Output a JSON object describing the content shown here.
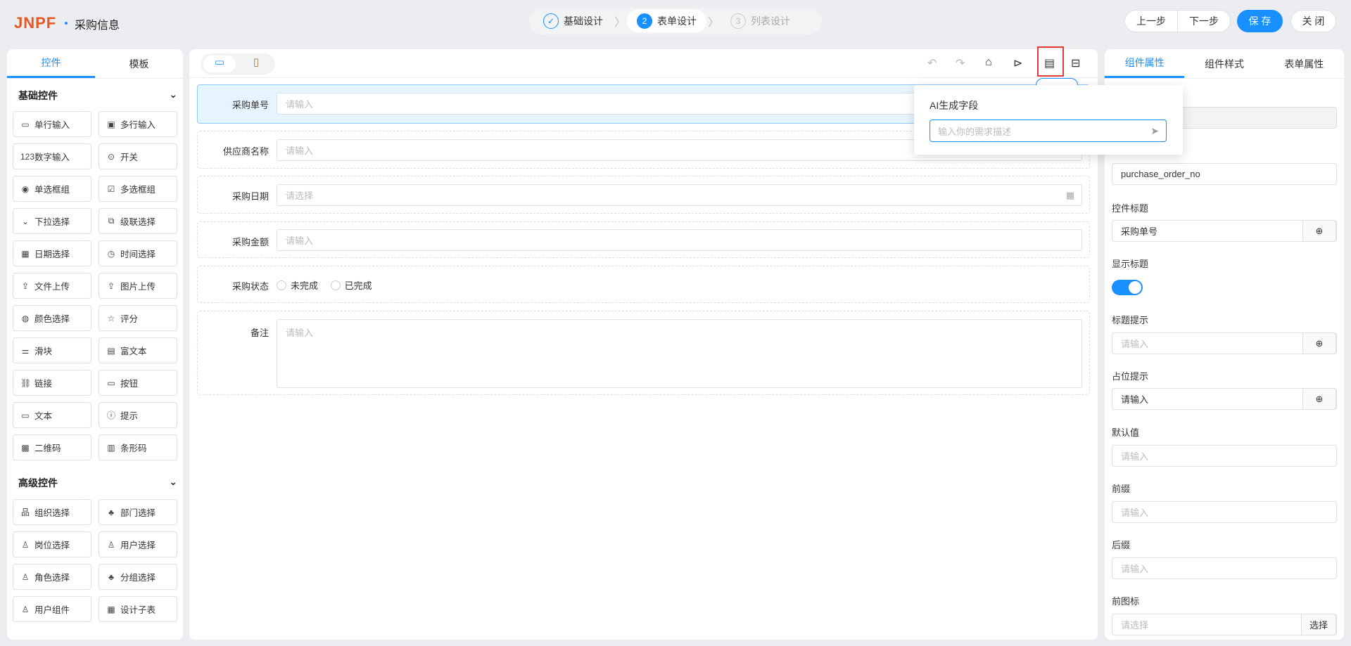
{
  "header": {
    "logo": "JNPF",
    "title": "采购信息",
    "steps": [
      {
        "num": "✓",
        "label": "基础设计"
      },
      {
        "num": "2",
        "label": "表单设计"
      },
      {
        "num": "3",
        "label": "列表设计"
      }
    ],
    "prev": "上一步",
    "next": "下一步",
    "save": "保 存",
    "close": "关 闭"
  },
  "left": {
    "tabs": [
      "控件",
      "模板"
    ],
    "basic_title": "基础控件",
    "advanced_title": "高级控件",
    "basic": [
      {
        "i": "▭",
        "l": "单行输入"
      },
      {
        "i": "▣",
        "l": "多行输入"
      },
      {
        "i": "123",
        "l": "数字输入"
      },
      {
        "i": "⊙",
        "l": "开关"
      },
      {
        "i": "◉",
        "l": "单选框组"
      },
      {
        "i": "☑",
        "l": "多选框组"
      },
      {
        "i": "⌄",
        "l": "下拉选择"
      },
      {
        "i": "⧉",
        "l": "级联选择"
      },
      {
        "i": "▦",
        "l": "日期选择"
      },
      {
        "i": "◷",
        "l": "时间选择"
      },
      {
        "i": "⇪",
        "l": "文件上传"
      },
      {
        "i": "⇪",
        "l": "图片上传"
      },
      {
        "i": "◍",
        "l": "颜色选择"
      },
      {
        "i": "☆",
        "l": "评分"
      },
      {
        "i": "⚌",
        "l": "滑块"
      },
      {
        "i": "▤",
        "l": "富文本"
      },
      {
        "i": "⛓",
        "l": "链接"
      },
      {
        "i": "▭",
        "l": "按钮"
      },
      {
        "i": "▭",
        "l": "文本"
      },
      {
        "i": "ⓘ",
        "l": "提示"
      },
      {
        "i": "▩",
        "l": "二维码"
      },
      {
        "i": "▥",
        "l": "条形码"
      }
    ],
    "advanced": [
      {
        "i": "品",
        "l": "组织选择"
      },
      {
        "i": "♣",
        "l": "部门选择"
      },
      {
        "i": "♙",
        "l": "岗位选择"
      },
      {
        "i": "♙",
        "l": "用户选择"
      },
      {
        "i": "♙",
        "l": "角色选择"
      },
      {
        "i": "♣",
        "l": "分组选择"
      },
      {
        "i": "♙",
        "l": "用户组件"
      },
      {
        "i": "▦",
        "l": "设计子表"
      }
    ]
  },
  "form": {
    "items": [
      {
        "label": "采购单号",
        "placeholder": "请输入"
      },
      {
        "label": "供应商名称",
        "placeholder": "请输入"
      },
      {
        "label": "采购日期",
        "placeholder": "请选择"
      },
      {
        "label": "采购金额",
        "placeholder": "请输入"
      }
    ],
    "status": {
      "label": "采购状态",
      "options": [
        "未完成",
        "已完成"
      ]
    },
    "remark": {
      "label": "备注",
      "placeholder": "请输入"
    }
  },
  "popover": {
    "title": "AI生成字段",
    "placeholder": "输入你的需求描述"
  },
  "right": {
    "tabs": [
      "组件属性",
      "组件样式",
      "表单属性"
    ],
    "field_value": "purchase_order_no",
    "title_label": "控件标题",
    "title_value": "采购单号",
    "show_title": "显示标题",
    "show_title_on": true,
    "tip_label": "标题提示",
    "tip_ph": "请输入",
    "ph_label": "占位提示",
    "ph_value": "请输入",
    "default_label": "默认值",
    "default_ph": "请输入",
    "prefix_label": "前缀",
    "prefix_ph": "请输入",
    "suffix_label": "后缀",
    "suffix_ph": "请输入",
    "icon_label": "前图标",
    "icon_ph": "请选择",
    "icon_btn": "选择"
  },
  "colors": {
    "accent": "#1890ff",
    "highlight": "#e53935"
  }
}
